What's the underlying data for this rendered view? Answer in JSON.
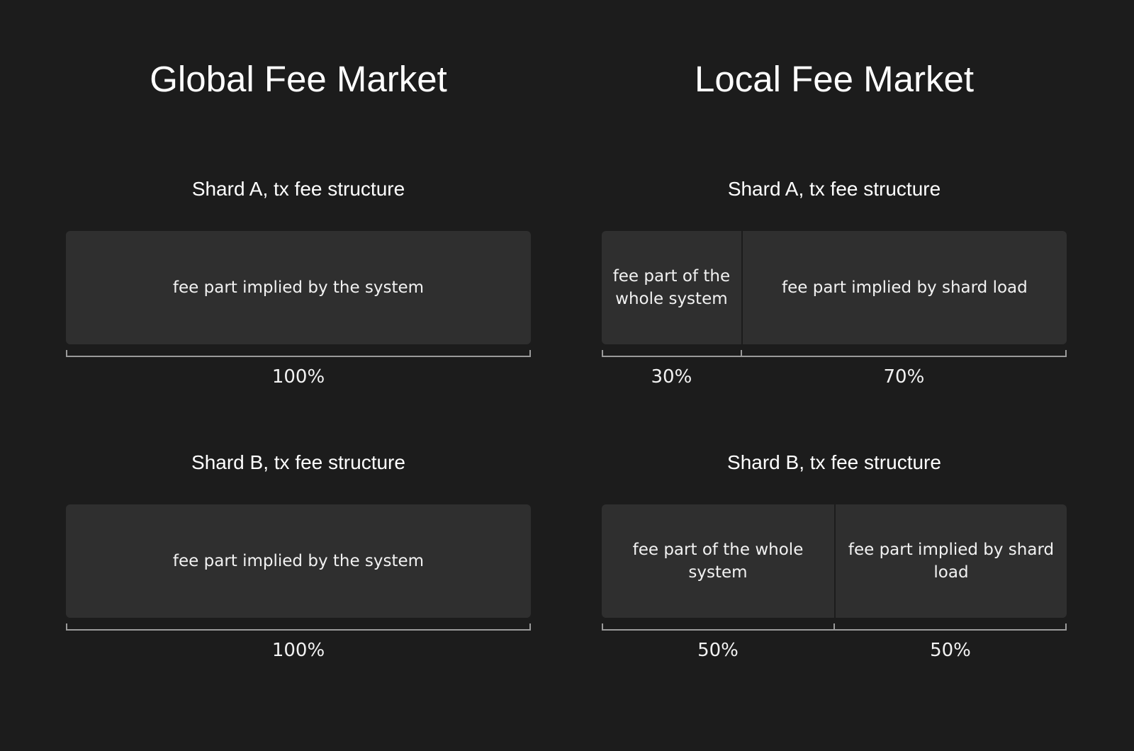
{
  "columns": [
    {
      "id": "global",
      "title": "Global Fee Market",
      "shards": [
        {
          "id": "a",
          "title": "Shard A, tx fee structure",
          "segments": [
            {
              "label": "fee part implied by the system",
              "percent_label": "100%",
              "share": 100
            }
          ]
        },
        {
          "id": "b",
          "title": "Shard B, tx fee structure",
          "segments": [
            {
              "label": "fee part implied by the system",
              "percent_label": "100%",
              "share": 100
            }
          ]
        }
      ]
    },
    {
      "id": "local",
      "title": "Local Fee Market",
      "shards": [
        {
          "id": "a",
          "title": "Shard A, tx fee structure",
          "segments": [
            {
              "label": "fee part of the whole system",
              "percent_label": "30%",
              "share": 30
            },
            {
              "label": "fee part implied by shard load",
              "percent_label": "70%",
              "share": 70
            }
          ]
        },
        {
          "id": "b",
          "title": "Shard B, tx fee structure",
          "segments": [
            {
              "label": "fee part of the whole system",
              "percent_label": "50%",
              "share": 50
            },
            {
              "label": "fee part implied by shard load",
              "percent_label": "50%",
              "share": 50
            }
          ]
        }
      ]
    }
  ],
  "colors": {
    "background": "#1c1c1c",
    "segment_fill": "#2f2f2f",
    "bracket": "#9a9a9a",
    "text": "#ffffff"
  }
}
